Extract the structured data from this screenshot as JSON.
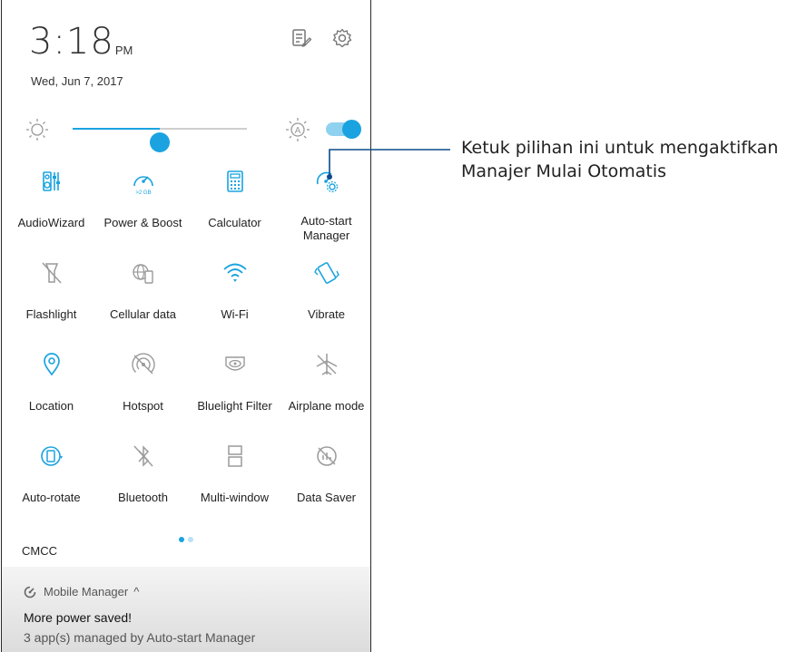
{
  "status": {
    "time_hm": "3:18",
    "ampm": "PM",
    "date": "Wed, Jun 7, 2017",
    "top_icons": [
      "edit-list-icon",
      "settings-gear-icon"
    ]
  },
  "brightness": {
    "level": 0.5,
    "auto": true,
    "accent": "#1aa3e0"
  },
  "tiles": [
    {
      "label": "AudioWizard",
      "icon": "audiowizard-icon",
      "active": true
    },
    {
      "label": "Power & Boost",
      "icon": "power-boost-icon",
      "active": true,
      "badge": ">2 GB"
    },
    {
      "label": "Calculator",
      "icon": "calculator-icon",
      "active": true
    },
    {
      "label": "Auto-start Manager",
      "icon": "auto-start-manager-icon",
      "active": true
    },
    {
      "label": "Flashlight",
      "icon": "flashlight-icon",
      "active": false
    },
    {
      "label": "Cellular data",
      "icon": "cellular-data-icon",
      "active": false
    },
    {
      "label": "Wi-Fi",
      "icon": "wifi-icon",
      "active": true
    },
    {
      "label": "Vibrate",
      "icon": "vibrate-icon",
      "active": true
    },
    {
      "label": "Location",
      "icon": "location-icon",
      "active": true
    },
    {
      "label": "Hotspot",
      "icon": "hotspot-icon",
      "active": false
    },
    {
      "label": "Bluelight Filter",
      "icon": "bluelight-filter-icon",
      "active": false
    },
    {
      "label": "Airplane mode",
      "icon": "airplane-icon",
      "active": false
    },
    {
      "label": "Auto-rotate",
      "icon": "auto-rotate-icon",
      "active": true
    },
    {
      "label": "Bluetooth",
      "icon": "bluetooth-icon",
      "active": false
    },
    {
      "label": "Multi-window",
      "icon": "multi-window-icon",
      "active": false
    },
    {
      "label": "Data Saver",
      "icon": "data-saver-icon",
      "active": false
    }
  ],
  "pager": {
    "pages": 2,
    "current": 1
  },
  "carrier": "CMCC",
  "notification": {
    "app": "Mobile Manager",
    "title": "More power saved!",
    "text": "3 app(s) managed by Auto-start Manager"
  },
  "callout": {
    "text": "Ketuk pilihan ini untuk mengaktifkan Manajer Mulai Otomatis"
  },
  "colors": {
    "active": "#1aa3e0",
    "inactive": "#9a9a9a"
  }
}
